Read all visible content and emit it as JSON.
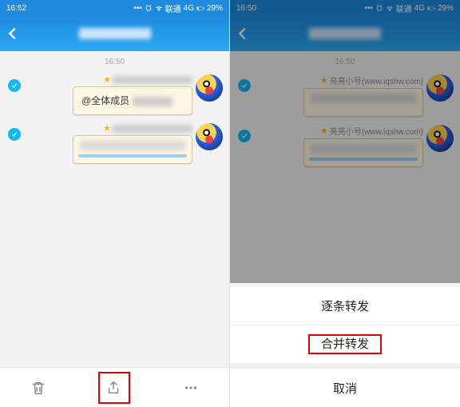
{
  "statusbar": {
    "time_left": "16:52",
    "time_right": "16:50",
    "carrier": "联通",
    "network": "4G",
    "battery": "29%"
  },
  "chat": {
    "timestamp": "16:50",
    "mention_text": "@全体成员",
    "sender_name": "亮亮小号(www.iqshw.com)"
  },
  "action_sheet": {
    "item1": "逐条转发",
    "item2": "合并转发",
    "cancel": "取消"
  },
  "icons": {
    "back": "back",
    "delete": "delete",
    "share": "share",
    "more": "more"
  }
}
